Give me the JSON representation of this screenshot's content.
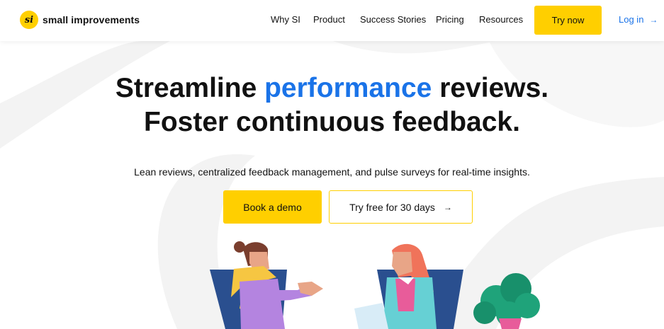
{
  "header": {
    "logo_mark": "si",
    "logo_text": "small improvements",
    "nav": [
      "Why SI",
      "Product",
      "Success Stories",
      "Pricing",
      "Resources"
    ],
    "try_now_label": "Try now",
    "login_label": "Log in",
    "login_arrow": "→"
  },
  "hero": {
    "headline_line1_a": "Streamline ",
    "headline_line1_highlight": "performance",
    "headline_line1_b": " reviews.",
    "headline_line2": "Foster continuous feedback.",
    "subtext": "Lean reviews, centralized feedback management, and pulse surveys for real-time insights.",
    "primary_cta": "Book a demo",
    "secondary_cta": "Try free for 30 days",
    "secondary_cta_arrow": "→"
  },
  "colors": {
    "brand_yellow": "#FFCF00",
    "accent_blue": "#1A73E8",
    "text": "#111111",
    "background_decoration": "#F3F3F3"
  }
}
